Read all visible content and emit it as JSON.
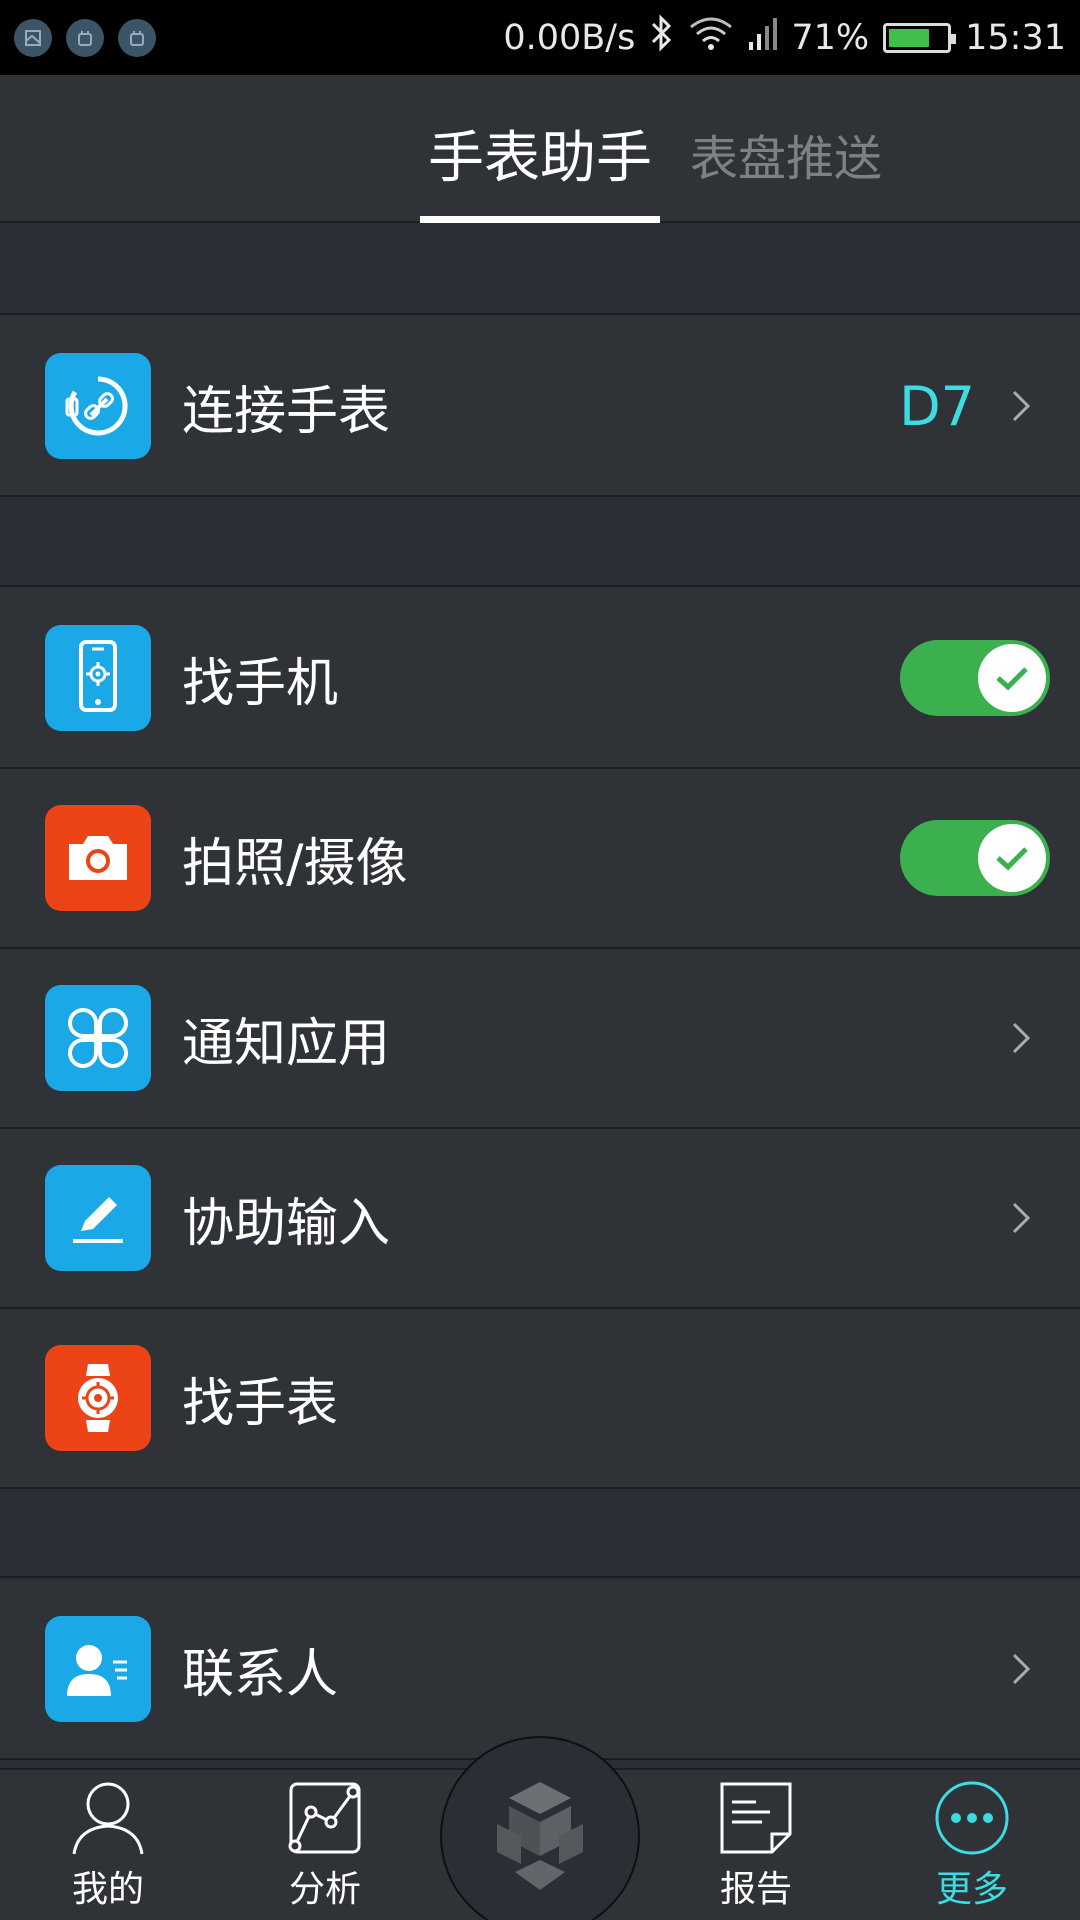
{
  "status_bar": {
    "net_speed": "0.00B/s",
    "battery_percent": "71%",
    "time": "15:31",
    "battery_level": 0.71
  },
  "header": {
    "tabs": [
      {
        "label": "手表助手",
        "active": true
      },
      {
        "label": "表盘推送",
        "active": false
      }
    ]
  },
  "rows": [
    {
      "label": "连接手表",
      "value": "D7",
      "icon": "watch-link-icon",
      "icon_color": "#1ba8e6"
    },
    {
      "label": "找手机",
      "toggle": true,
      "icon": "find-phone-icon",
      "icon_color": "#1ba8e6"
    },
    {
      "label": "拍照/摄像",
      "toggle": true,
      "icon": "camera-icon",
      "icon_color": "#ec4317"
    },
    {
      "label": "通知应用",
      "icon": "apps-grid-icon",
      "icon_color": "#1ba8e6"
    },
    {
      "label": "协助输入",
      "icon": "pen-icon",
      "icon_color": "#1ba8e6"
    },
    {
      "label": "找手表",
      "icon": "find-watch-icon",
      "icon_color": "#ec4317"
    },
    {
      "label": "联系人",
      "icon": "contacts-icon",
      "icon_color": "#1ba8e6"
    }
  ],
  "bottom_nav": {
    "items": [
      {
        "label": "我的",
        "icon": "person-icon"
      },
      {
        "label": "分析",
        "icon": "chart-icon"
      },
      {
        "label": "",
        "icon": "cube-logo-icon"
      },
      {
        "label": "报告",
        "icon": "report-icon"
      },
      {
        "label": "更多",
        "icon": "more-icon",
        "active": true
      }
    ]
  },
  "colors": {
    "accent": "#3ddce3",
    "toggle_on": "#3cb04f",
    "icon_blue": "#1ba8e6",
    "icon_red": "#ec4317",
    "background": "#2b2e34"
  }
}
